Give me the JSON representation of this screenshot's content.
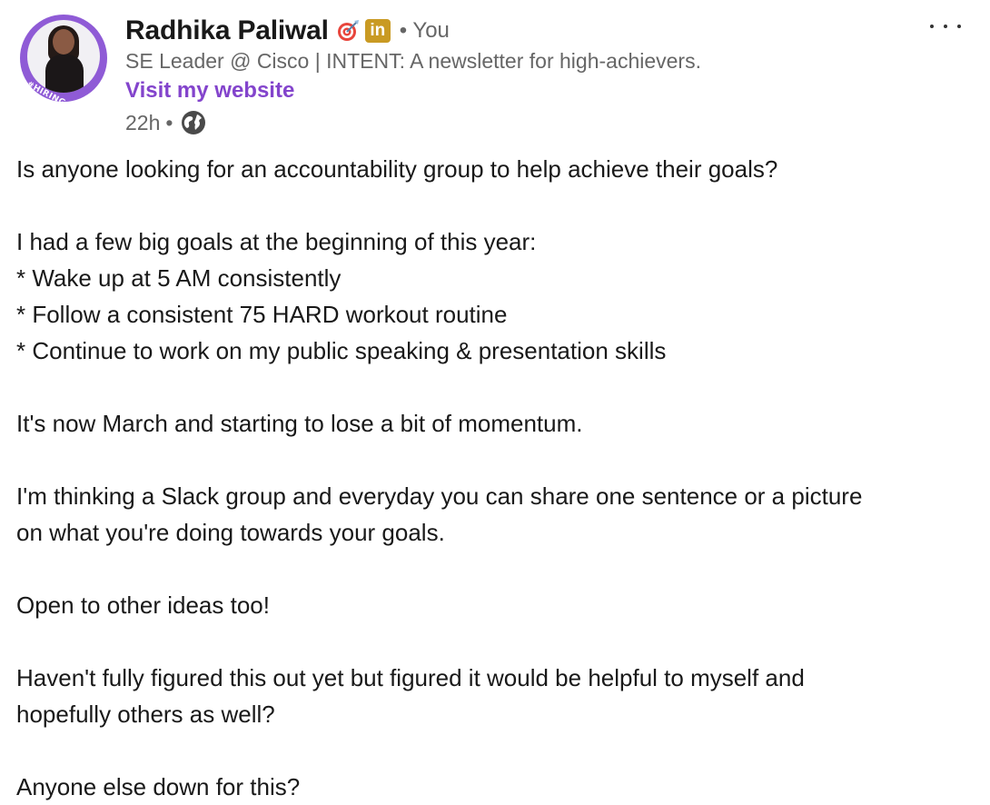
{
  "author": {
    "name": "Radhika Paliwal",
    "avatar_badge": "#HIRING",
    "relation": "You",
    "relation_separator": "•",
    "headline": "SE Leader @ Cisco | INTENT: A newsletter for high-achievers.",
    "website_link": "Visit my website",
    "linkedin_badge": "in"
  },
  "meta": {
    "time": "22h",
    "separator": "•",
    "visibility_icon": "globe-icon"
  },
  "colors": {
    "link_purple": "#8344cc",
    "avatar_ring": "#8f5bd6",
    "linkedin_badge_gold": "#c99a23",
    "secondary_text": "#666666"
  },
  "post": {
    "lines": [
      "Is anyone looking for an accountability group to help achieve their goals?",
      "",
      "I had a few big goals at the beginning of this year:",
      "* Wake up at 5 AM consistently",
      "* Follow a consistent 75 HARD workout routine",
      "* Continue to work on my public speaking & presentation skills",
      "",
      "It's now March and starting to lose a bit of momentum.",
      "",
      "I'm thinking a Slack group and everyday you can share one sentence or a picture",
      "on what you're doing towards your goals.",
      "",
      "Open to other ideas too!",
      "",
      "Haven't fully figured this out yet but figured it would be helpful to myself and",
      "hopefully others as well?",
      "",
      "Anyone else down for this?"
    ]
  }
}
